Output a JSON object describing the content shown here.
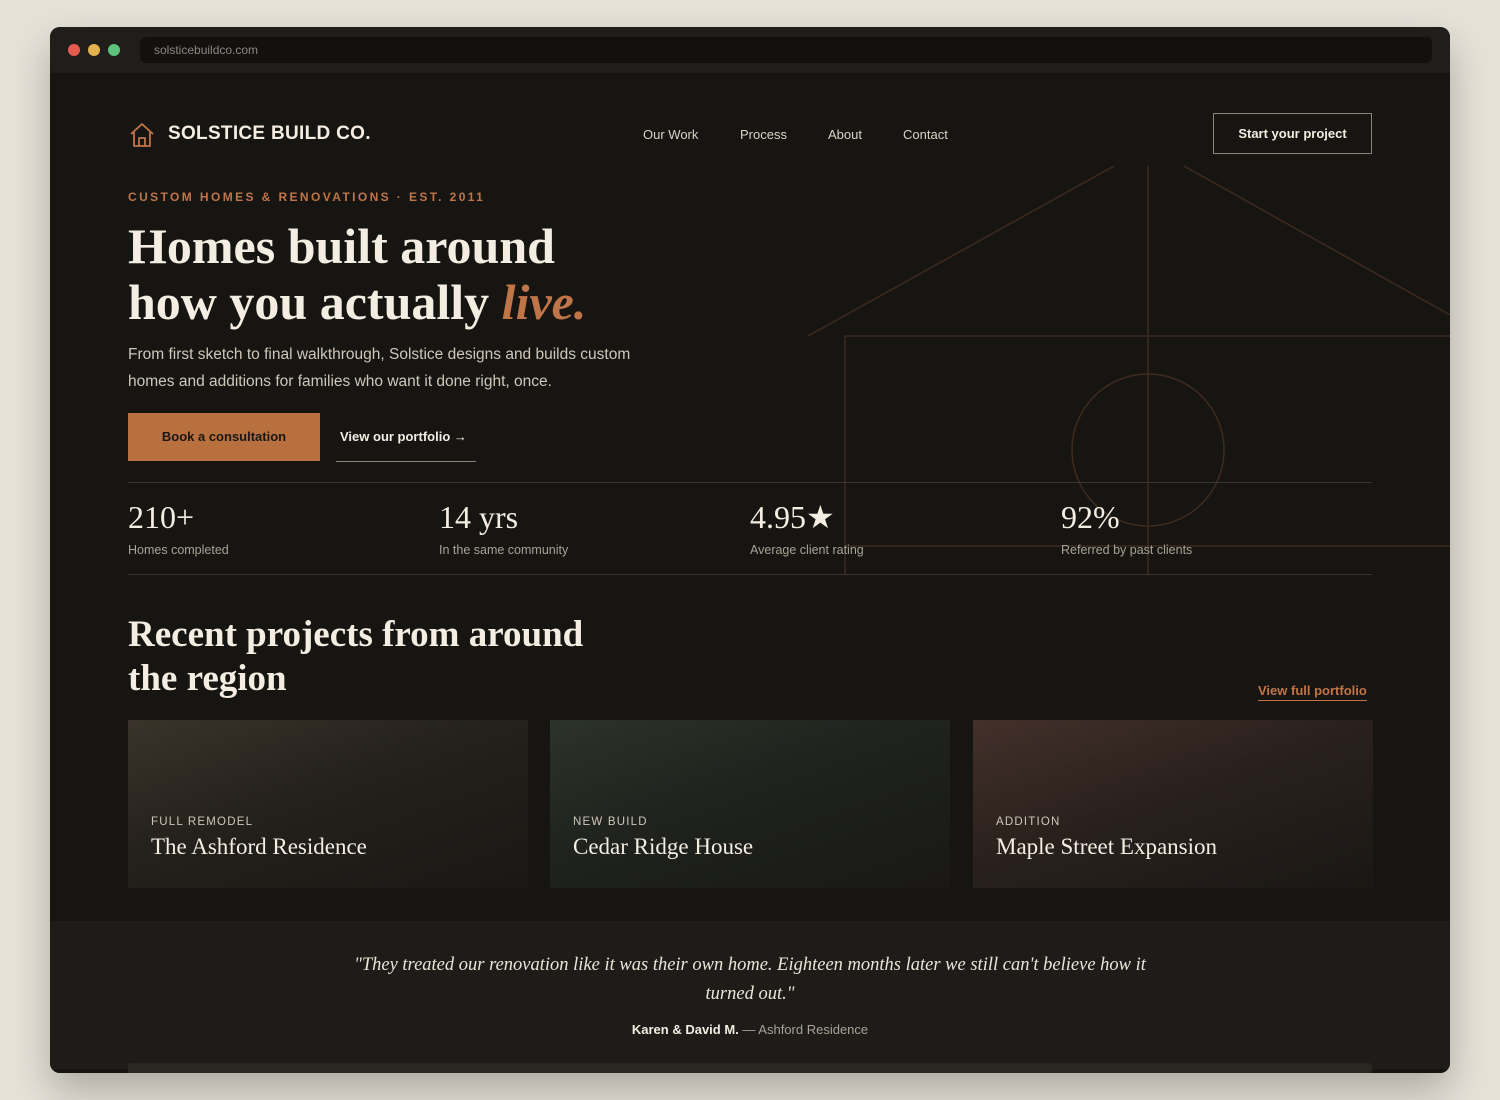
{
  "browser": {
    "url": "solsticebuildco.com"
  },
  "header": {
    "brand": "SOLSTICE BUILD CO.",
    "logo_icon": "house-outline-icon",
    "nav": [
      "Our Work",
      "Process",
      "About",
      "Contact"
    ],
    "cta": "Start your project"
  },
  "hero": {
    "eyebrow": "CUSTOM HOMES & RENOVATIONS · EST. 2011",
    "title_line1": "Homes built around",
    "title_line2": "how you actually ",
    "title_accent": "live.",
    "subtitle": "From first sketch to final walkthrough, Solstice designs and builds custom homes and additions for families who want it done right, once.",
    "primary_button": "Book a consultation",
    "secondary_link": "View our portfolio →"
  },
  "stats": [
    {
      "value": "210+",
      "label": "Homes completed"
    },
    {
      "value": "14 yrs",
      "label": "In the same community"
    },
    {
      "value": "4.95★",
      "label": "Average client rating"
    },
    {
      "value": "92%",
      "label": "Referred by past clients"
    }
  ],
  "projects": {
    "title_line1": "Recent projects from around",
    "title_line2": "the region",
    "view_all": "View full portfolio",
    "items": [
      {
        "tag": "FULL REMODEL",
        "title": "The Ashford Residence"
      },
      {
        "tag": "NEW BUILD",
        "title": "Cedar Ridge House"
      },
      {
        "tag": "ADDITION",
        "title": "Maple Street Expansion"
      }
    ]
  },
  "testimonial": {
    "quote": "\"They treated our renovation like it was their own home. Eighteen months later we still can't believe how it turned out.\"",
    "author": "Karen & David M.",
    "project": " — Ashford Residence"
  },
  "colors": {
    "accent": "#c07548",
    "background": "#171512",
    "text": "#f3ede2"
  }
}
